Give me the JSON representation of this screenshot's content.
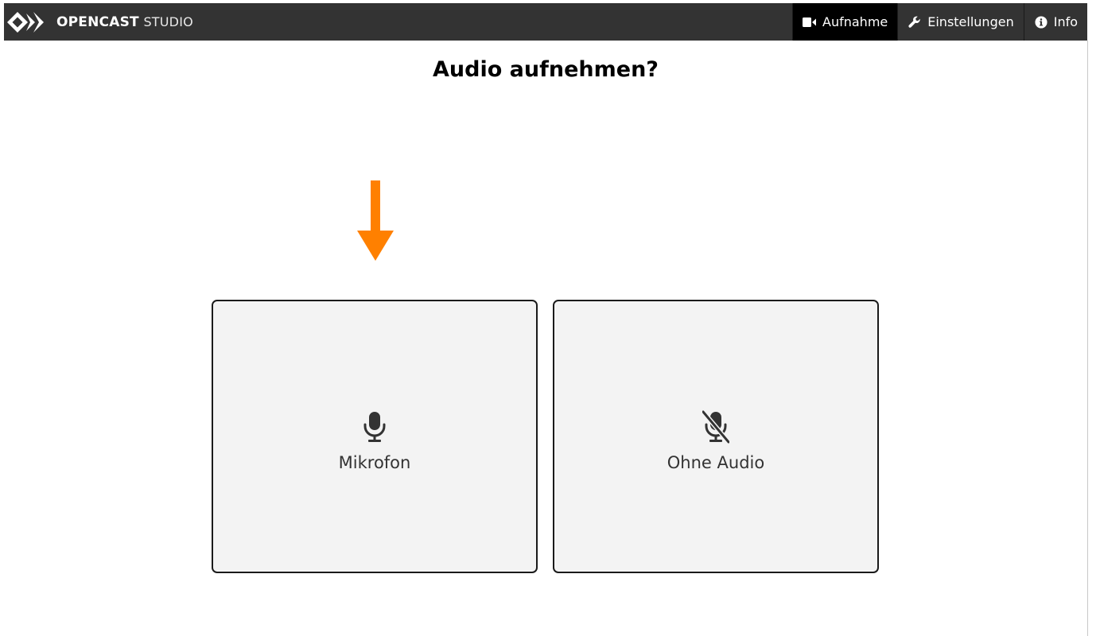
{
  "app": {
    "brand_bold": "OPENCAST",
    "brand_light": "STUDIO"
  },
  "nav": {
    "items": [
      {
        "label": "Aufnahme",
        "icon": "video-camera-icon",
        "active": true
      },
      {
        "label": "Einstellungen",
        "icon": "wrench-icon",
        "active": false
      },
      {
        "label": "Info",
        "icon": "info-circle-icon",
        "active": false
      }
    ]
  },
  "main": {
    "title": "Audio aufnehmen?",
    "hint_icon": "arrow-down-icon",
    "options": [
      {
        "label": "Mikrofon",
        "icon": "microphone-icon"
      },
      {
        "label": "Ohne Audio",
        "icon": "microphone-slash-icon"
      }
    ]
  },
  "colors": {
    "header_bg": "#333333",
    "active_nav_bg": "#000000",
    "accent_arrow": "#ff8000",
    "card_bg": "#f3f3f3",
    "card_border": "#1a1a1a"
  }
}
